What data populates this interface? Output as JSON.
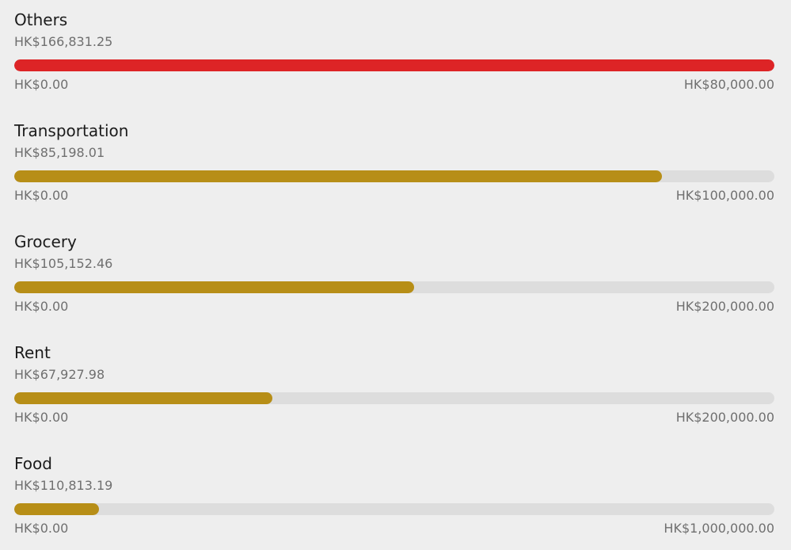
{
  "colors": {
    "over_budget": "#dd2426",
    "within_budget": "#b78e17",
    "track": "#dddddd"
  },
  "budgets": [
    {
      "category": "Others",
      "spent": "HK$166,831.25",
      "min": "HK$0.00",
      "max": "HK$80,000.00",
      "progress": 1.0,
      "status": "over_budget"
    },
    {
      "category": "Transportation",
      "spent": "HK$85,198.01",
      "min": "HK$0.00",
      "max": "HK$100,000.00",
      "progress": 0.852,
      "status": "within_budget"
    },
    {
      "category": "Grocery",
      "spent": "HK$105,152.46",
      "min": "HK$0.00",
      "max": "HK$200,000.00",
      "progress": 0.526,
      "status": "within_budget"
    },
    {
      "category": "Rent",
      "spent": "HK$67,927.98",
      "min": "HK$0.00",
      "max": "HK$200,000.00",
      "progress": 0.34,
      "status": "within_budget"
    },
    {
      "category": "Food",
      "spent": "HK$110,813.19",
      "min": "HK$0.00",
      "max": "HK$1,000,000.00",
      "progress": 0.111,
      "status": "within_budget"
    }
  ]
}
